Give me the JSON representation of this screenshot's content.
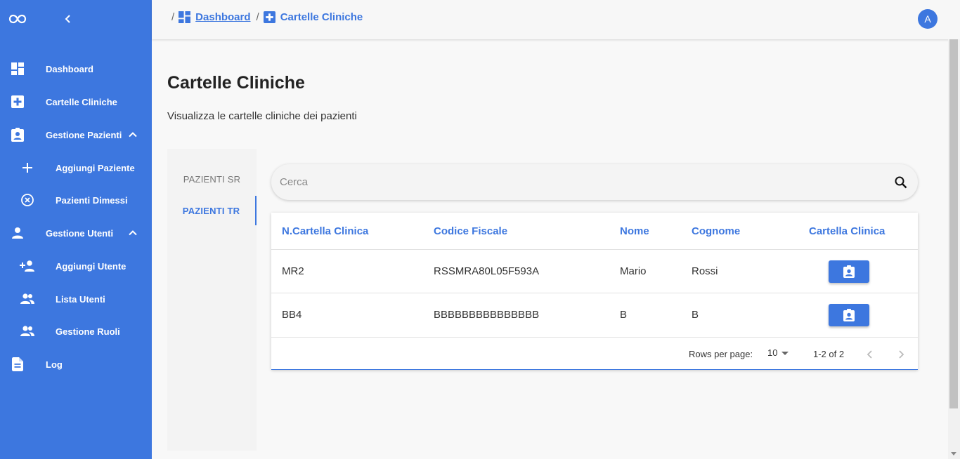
{
  "sidebar": {
    "items": [
      {
        "label": "Dashboard",
        "icon": "dashboard-icon"
      },
      {
        "label": "Cartelle Cliniche",
        "icon": "medical-plus-icon"
      },
      {
        "label": "Gestione Pazienti",
        "icon": "clipboard-account-icon"
      },
      {
        "label": "Aggiungi Paziente",
        "icon": "plus-icon"
      },
      {
        "label": "Pazienti Dimessi",
        "icon": "cancel-circle-icon"
      },
      {
        "label": "Gestione Utenti",
        "icon": "account-icon"
      },
      {
        "label": "Aggiungi Utente",
        "icon": "account-plus-icon"
      },
      {
        "label": "Lista Utenti",
        "icon": "account-group-icon"
      },
      {
        "label": "Gestione Ruoli",
        "icon": "account-group-icon"
      },
      {
        "label": "Log",
        "icon": "file-document-icon"
      }
    ]
  },
  "topbar": {
    "breadcrumb": [
      {
        "label": "Dashboard",
        "icon": "dashboard-icon"
      },
      {
        "label": "Cartelle Cliniche",
        "icon": "medical-plus-icon"
      }
    ],
    "separator": "/",
    "avatar_initial": "A"
  },
  "page": {
    "title": "Cartelle Cliniche",
    "subtitle": "Visualizza le cartelle cliniche dei pazienti"
  },
  "tabs": [
    {
      "label": "PAZIENTI SR",
      "active": false
    },
    {
      "label": "PAZIENTI TR",
      "active": true
    }
  ],
  "search": {
    "placeholder": "Cerca",
    "value": ""
  },
  "table": {
    "headers": [
      "N.Cartella Clinica",
      "Codice Fiscale",
      "Nome",
      "Cognome",
      "Cartella Clinica"
    ],
    "rows": [
      {
        "n": "MR2",
        "cf": "RSSMRA80L05F593A",
        "nome": "Mario",
        "cognome": "Rossi"
      },
      {
        "n": "BB4",
        "cf": "BBBBBBBBBBBBBBB",
        "nome": "B",
        "cognome": "B"
      }
    ],
    "footer": {
      "rows_per_page_label": "Rows per page:",
      "rows_per_page": "10",
      "range": "1-2 of 2"
    }
  },
  "colors": {
    "accent": "#3d77df",
    "background": "#f8f8f8"
  }
}
